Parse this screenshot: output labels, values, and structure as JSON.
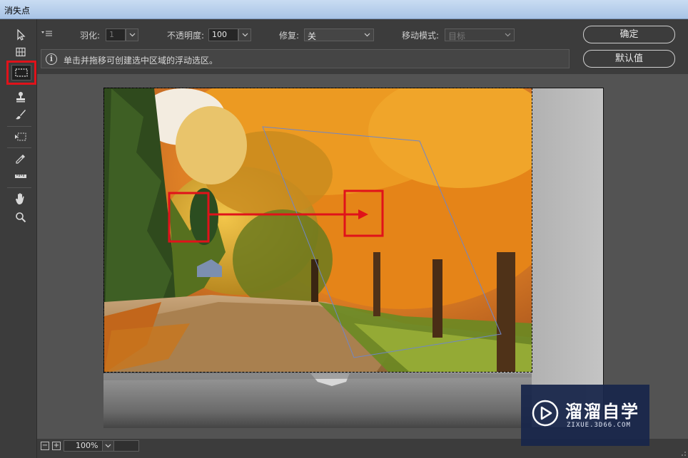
{
  "window": {
    "title": "消失点"
  },
  "tools": [
    {
      "name": "edit-plane-tool",
      "icon": "arrow-icon"
    },
    {
      "name": "create-plane-tool",
      "icon": "grid-icon"
    },
    {
      "name": "marquee-tool",
      "icon": "marquee-icon",
      "active": true
    },
    {
      "name": "stamp-tool",
      "icon": "stamp-icon"
    },
    {
      "name": "brush-tool",
      "icon": "brush-icon"
    },
    {
      "name": "transform-tool",
      "icon": "transform-icon"
    },
    {
      "name": "eyedropper-tool",
      "icon": "eyedropper-icon"
    },
    {
      "name": "measure-tool",
      "icon": "ruler-icon"
    },
    {
      "name": "hand-tool",
      "icon": "hand-icon"
    },
    {
      "name": "zoom-tool",
      "icon": "zoom-icon"
    }
  ],
  "options": {
    "feather_label": "羽化:",
    "feather_value": "1",
    "opacity_label": "不透明度:",
    "opacity_value": "100",
    "heal_label": "修复:",
    "heal_value": "关",
    "move_mode_label": "移动模式:",
    "move_mode_value": "目标"
  },
  "info": {
    "text": "单击并拖移可创建选中区域的浮动选区。"
  },
  "buttons": {
    "ok": "确定",
    "default": "默认值"
  },
  "status": {
    "zoom": "100%"
  },
  "watermark": {
    "name": "溜溜自学",
    "url": "ZIXUE.3D66.COM"
  },
  "colors": {
    "accent_red": "#e0121a",
    "plane_blue": "#6f86c8",
    "panel": "#3c3c3c",
    "canvas_bg": "#535353"
  }
}
